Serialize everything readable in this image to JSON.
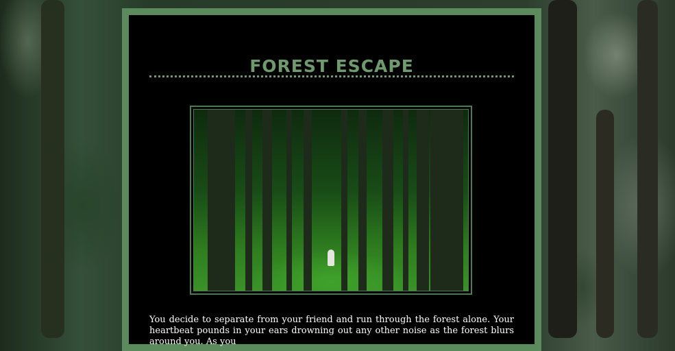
{
  "game": {
    "title": "FOREST ESCAPE",
    "scene_image": "forest-path-photo",
    "story_text": "You decide to separate from your friend and run through the forest alone. Your heartbeat pounds in your ears drowning out any other noise as the forest blurs around you. As you"
  },
  "colors": {
    "accent": "#5b8a5c",
    "title": "#6f9a6d",
    "panel_bg": "#000000",
    "text": "#ffffff"
  }
}
